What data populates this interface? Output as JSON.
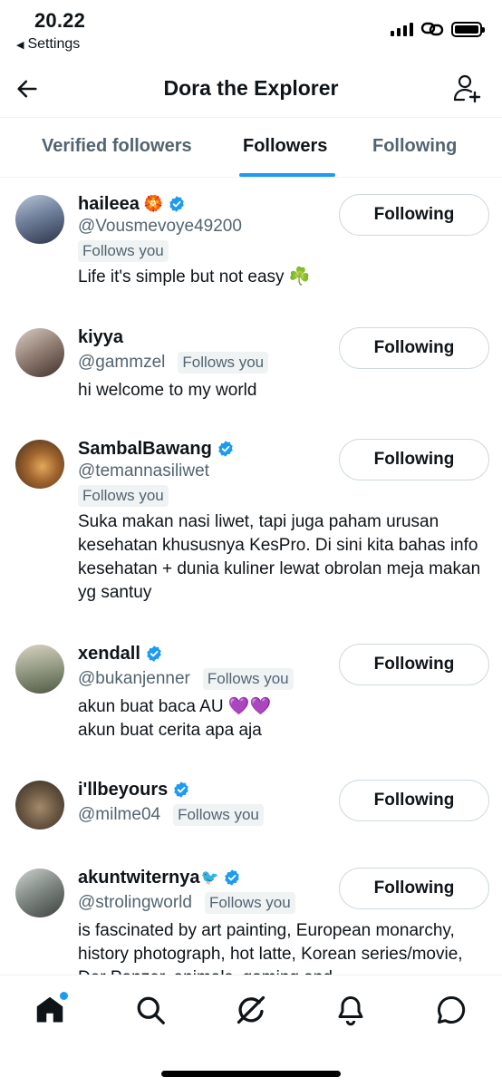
{
  "status": {
    "time": "20.22",
    "back_label": "Settings"
  },
  "header": {
    "title": "Dora the Explorer"
  },
  "tabs": [
    {
      "label": "Verified followers"
    },
    {
      "label": "Followers"
    },
    {
      "label": "Following"
    }
  ],
  "active_tab": "Followers",
  "accent_color": "#1d9bf0",
  "users": [
    {
      "name": "haileea",
      "name_suffix": "🏵️",
      "verified": true,
      "handle": "@Vousmevoye49200",
      "follows_you": "Follows you",
      "bio": "Life it's simple but not easy ☘️",
      "button": "Following"
    },
    {
      "name": "kiyya",
      "name_suffix": "",
      "verified": false,
      "handle": "@gammzel",
      "follows_you": "Follows you",
      "bio": "hi welcome to my world",
      "button": "Following"
    },
    {
      "name": "SambalBawang",
      "name_suffix": "",
      "verified": true,
      "handle": "@temannasiliwet",
      "follows_you": "Follows you",
      "bio": "Suka makan nasi liwet, tapi juga paham urusan kesehatan khususnya KesPro. Di sini kita bahas info kesehatan + dunia kuliner lewat obrolan meja makan yg santuy",
      "button": "Following"
    },
    {
      "name": "xendall",
      "name_suffix": "",
      "verified": true,
      "handle": "@bukanjenner",
      "follows_you": "Follows you",
      "bio": "akun buat baca AU 💜💜\nakun buat cerita apa aja",
      "button": "Following"
    },
    {
      "name": "i'llbeyours",
      "name_suffix": "",
      "verified": true,
      "handle": "@milme04",
      "follows_you": "Follows you",
      "bio": "",
      "button": "Following"
    },
    {
      "name": "akuntwiternya",
      "name_suffix": "🐦",
      "verified": true,
      "handle": "@strolingworld",
      "follows_you": "Follows you",
      "bio": "is fascinated by art painting, European monarchy, history photograph, hot latte, Korean series/movie, Der Panzer, animals, gaming and",
      "button": "Following"
    }
  ],
  "bottom_nav": [
    {
      "icon": "home-icon"
    },
    {
      "icon": "search-icon"
    },
    {
      "icon": "grok-icon"
    },
    {
      "icon": "bell-icon"
    },
    {
      "icon": "messages-icon"
    }
  ]
}
